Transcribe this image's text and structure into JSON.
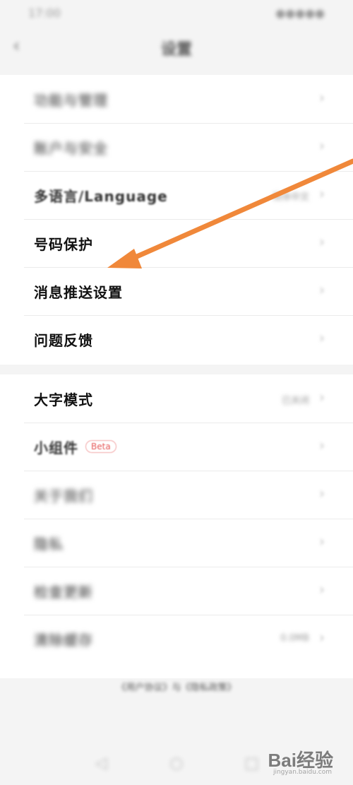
{
  "status_bar": {
    "time": "17:00",
    "indicators": "●●●●●"
  },
  "header": {
    "title": "设置",
    "back_icon": "back-arrow-icon"
  },
  "group_1": [
    {
      "label": "功能与管理",
      "value": ""
    },
    {
      "label": "账户与安全",
      "value": ""
    },
    {
      "label": "多语言/Language",
      "value": "简体中文"
    },
    {
      "label": "号码保护",
      "value": ""
    },
    {
      "label": "消息推送设置",
      "value": ""
    },
    {
      "label": "问题反馈",
      "value": ""
    }
  ],
  "group_2": [
    {
      "label": "大字模式",
      "value": "已关闭"
    },
    {
      "label": "小组件",
      "badge": "Beta",
      "value": ""
    },
    {
      "label": "关于我们",
      "value": ""
    },
    {
      "label": "隐私",
      "value": ""
    },
    {
      "label": "检查更新",
      "value": ""
    },
    {
      "label": "清除缓存",
      "value": "0.0MB"
    }
  ],
  "footer": {
    "text": "《用户协议》与《隐私政策》"
  },
  "watermark": {
    "text": "Bai经验",
    "sub": "jingyan.baidu.com"
  },
  "colors": {
    "arrow": "#f0883a",
    "badge": "#e65a5a"
  }
}
